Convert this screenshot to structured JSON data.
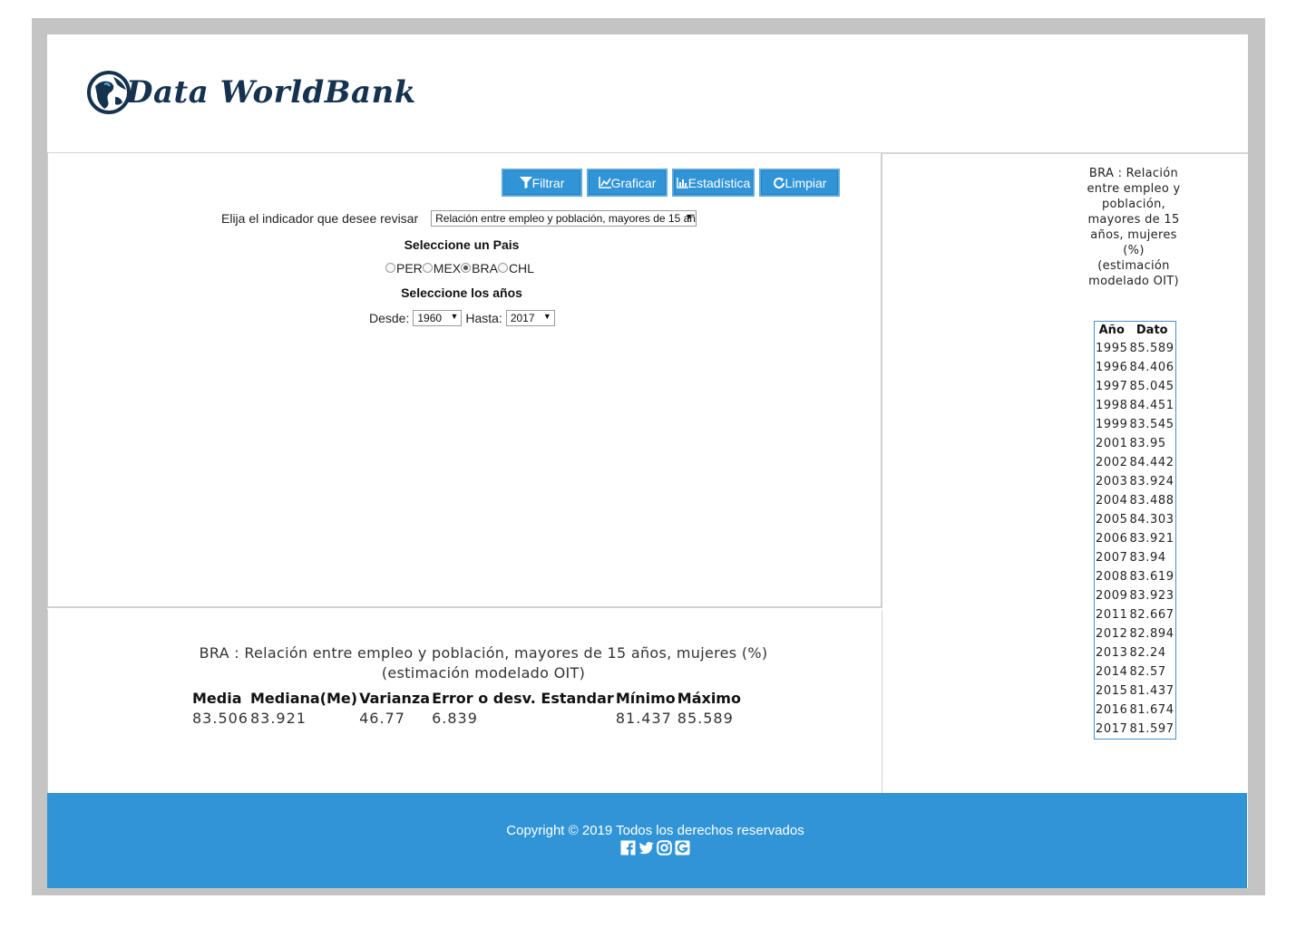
{
  "header": {
    "logo_text": "Data WorldBank"
  },
  "toolbar": {
    "filtrar_label": "Filtrar",
    "graficar_label": "Graficar",
    "estadistica_label": "Estadística",
    "limpiar_label": "Limpiar"
  },
  "form": {
    "indicator_label": "Elija el indicador que desee revisar",
    "indicator_value": "Relación entre empleo y población, mayores de 15 años, mujeres (%) (estimación modelado OIT)",
    "country_heading": "Seleccione un Pais",
    "countries": [
      {
        "code": "PER",
        "checked": false
      },
      {
        "code": "MEX",
        "checked": false
      },
      {
        "code": "BRA",
        "checked": true
      },
      {
        "code": "CHL",
        "checked": false
      }
    ],
    "years_heading": "Seleccione los años",
    "desde_label": "Desde:",
    "desde_value": "1960",
    "hasta_label": "Hasta:",
    "hasta_value": "2017"
  },
  "stats": {
    "title": "BRA : Relación entre empleo y población, mayores de 15 años, mujeres (%) (estimación modelado OIT)",
    "headers": [
      "Media",
      "Mediana(Me)",
      "Varianza",
      "Error o desv. Estandar",
      "Mínimo",
      "Máximo"
    ],
    "values": [
      "83.506",
      "83.921",
      "46.77",
      "6.839",
      "81.437",
      "85.589"
    ]
  },
  "data_table": {
    "title": "BRA : Relación entre empleo y población, mayores de 15 años, mujeres (%) (estimación modelado OIT)",
    "col_year": "Año",
    "col_value": "Dato",
    "rows": [
      [
        "1995",
        "85.589"
      ],
      [
        "1996",
        "84.406"
      ],
      [
        "1997",
        "85.045"
      ],
      [
        "1998",
        "84.451"
      ],
      [
        "1999",
        "83.545"
      ],
      [
        "2001",
        "83.95"
      ],
      [
        "2002",
        "84.442"
      ],
      [
        "2003",
        "83.924"
      ],
      [
        "2004",
        "83.488"
      ],
      [
        "2005",
        "84.303"
      ],
      [
        "2006",
        "83.921"
      ],
      [
        "2007",
        "83.94"
      ],
      [
        "2008",
        "83.619"
      ],
      [
        "2009",
        "83.923"
      ],
      [
        "2011",
        "82.667"
      ],
      [
        "2012",
        "82.894"
      ],
      [
        "2013",
        "82.24"
      ],
      [
        "2014",
        "82.57"
      ],
      [
        "2015",
        "81.437"
      ],
      [
        "2016",
        "81.674"
      ],
      [
        "2017",
        "81.597"
      ]
    ]
  },
  "footer": {
    "copyright": "Copyright © 2019 Todos los derechos reservados",
    "social_icons": [
      "facebook-icon",
      "twitter-icon",
      "instagram-icon",
      "google-icon"
    ]
  },
  "colors": {
    "accent": "#3194d6",
    "logo": "#15324f",
    "frame": "#c4c4c4",
    "table_border": "#4a8fc8"
  }
}
